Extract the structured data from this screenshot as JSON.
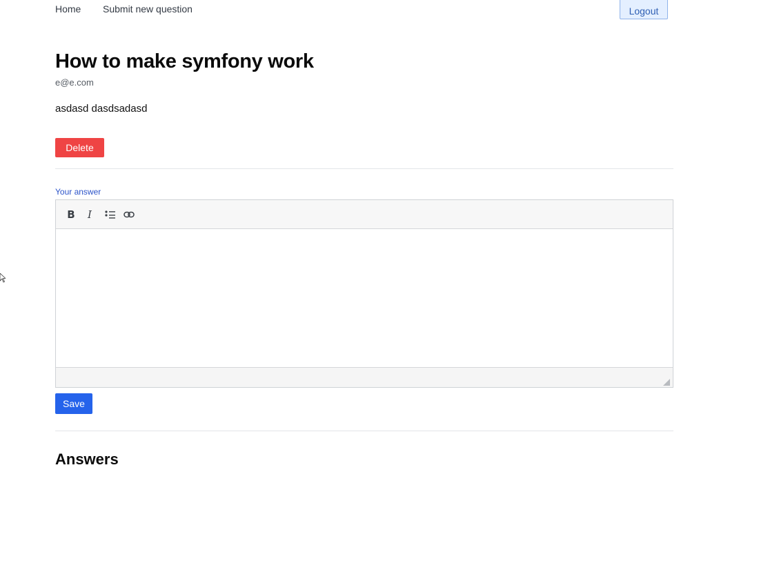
{
  "nav": {
    "home_label": "Home",
    "submit_label": "Submit new question",
    "logout_label": "Logout"
  },
  "question": {
    "title": "How to make symfony work",
    "author": "e@e.com",
    "body": "asdasd dasdsadasd",
    "delete_label": "Delete"
  },
  "answer_form": {
    "label": "Your answer",
    "toolbar": {
      "bold_icon": "bold-icon",
      "italic_icon": "italic-icon",
      "list_icon": "bullet-list-icon",
      "link_icon": "link-icon"
    },
    "value": "",
    "save_label": "Save"
  },
  "answers": {
    "heading": "Answers"
  },
  "colors": {
    "delete": "#ef4444",
    "save": "#2563eb",
    "label_blue": "#2b53c9",
    "logout_bg": "#e4efff"
  }
}
